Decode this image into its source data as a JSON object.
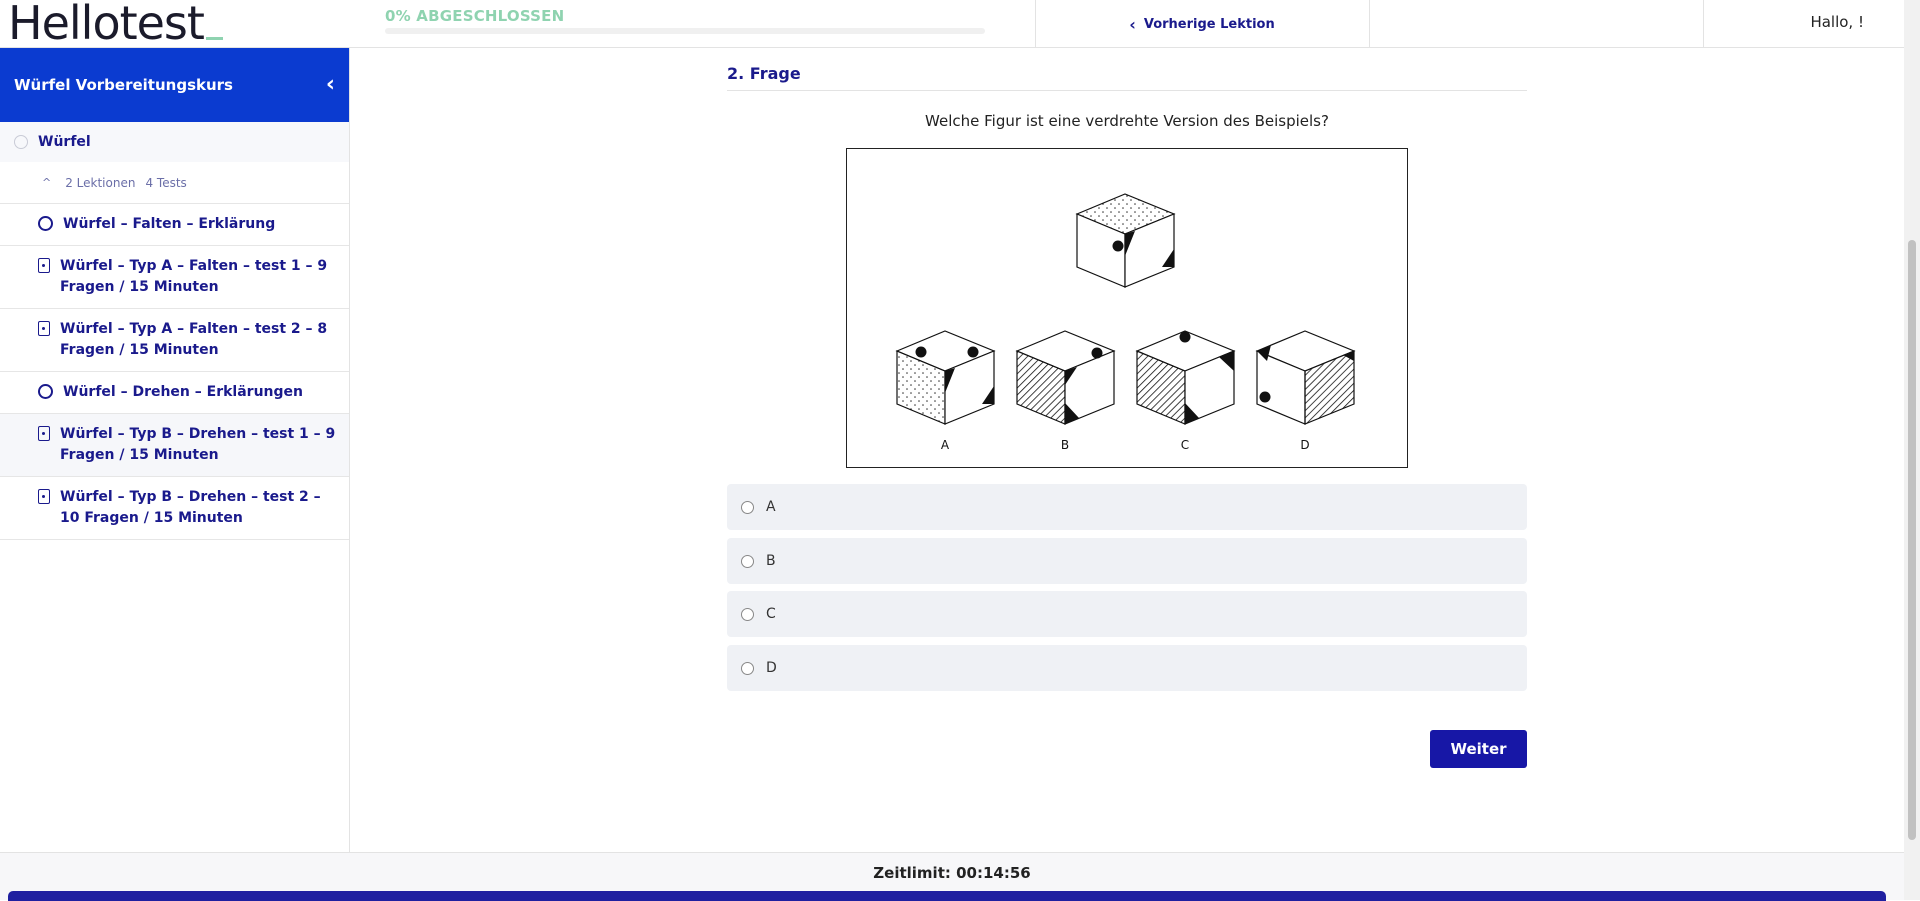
{
  "header": {
    "logo": "Hellotest",
    "progress_label": "0% ABGESCHLOSSEN",
    "progress_fraction": 0,
    "prev_lesson": "Vorherige Lektion",
    "greeting": "Hallo, !"
  },
  "sidebar": {
    "title": "Würfel Vorbereitungskurs",
    "section_title": "Würfel",
    "lessons_count": "2 Lektionen",
    "tests_count": "4 Tests",
    "items": [
      {
        "label": "Würfel – Falten – Erklärung",
        "icon": "circle-icon"
      },
      {
        "label": "Würfel – Typ A – Falten – test 1 – 9 Fragen / 15 Minuten",
        "icon": "document-icon"
      },
      {
        "label": "Würfel – Typ A – Falten – test 2 – 8 Fragen / 15 Minuten",
        "icon": "document-icon"
      },
      {
        "label": "Würfel – Drehen – Erklärungen",
        "icon": "circle-icon"
      },
      {
        "label": "Würfel – Typ B – Drehen – test 1 – 9 Fragen / 15 Minuten",
        "icon": "document-icon"
      },
      {
        "label": "Würfel – Typ B – Drehen – test 2 – 10 Fragen / 15 Minuten",
        "icon": "document-icon"
      }
    ]
  },
  "question": {
    "title": "2. Frage",
    "text": "Welche Figur ist eine verdrehte Version des Beispiels?",
    "figure_labels": [
      "A",
      "B",
      "C",
      "D"
    ],
    "options": [
      "A",
      "B",
      "C",
      "D"
    ],
    "next_button": "Weiter"
  },
  "footer": {
    "timer": "Zeitlimit: 00:14:56"
  },
  "colors": {
    "accent": "#1a1a8c",
    "sidebar_header": "#0b3bd0",
    "progress": "#8fd3b0",
    "button": "#1717a6"
  }
}
